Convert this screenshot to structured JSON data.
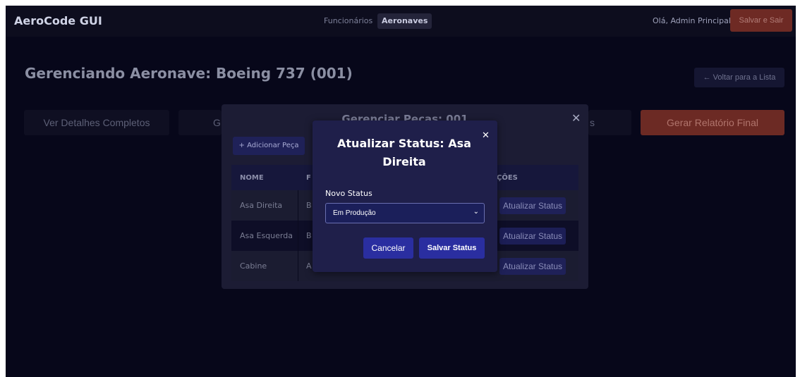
{
  "app": {
    "title": "AeroCode GUI"
  },
  "nav": {
    "items": [
      "Funcionários",
      "Aeronaves"
    ],
    "active": "Aeronaves"
  },
  "user": {
    "greeting": "Olá, Admin Principal",
    "logout_label": "Salvar e Sair"
  },
  "page": {
    "title": "Gerenciando Aeronave: Boeing 737 (001)",
    "back_label": "← Voltar para a Lista"
  },
  "actions": {
    "details_label": "Ver Detalhes Completos",
    "partial_left": "G",
    "partial_right": "s",
    "report_label": "Gerar Relatório Final"
  },
  "parts_modal": {
    "title": "Gerenciar Peças: 001",
    "add_label": "+ Adicionar Peça",
    "headers": {
      "name": "NOME",
      "second_partial": "F",
      "actions_partial": "ÇÕES"
    },
    "rows": [
      {
        "name": "Asa Direita",
        "second_partial": "B",
        "action": "Atualizar Status"
      },
      {
        "name": "Asa Esquerda",
        "second_partial": "B",
        "action": "Atualizar Status"
      },
      {
        "name": "Cabine",
        "second_partial": "A",
        "action": "Atualizar Status"
      }
    ],
    "close_glyph": "✕"
  },
  "status_modal": {
    "title": "Atualizar Status: Asa Direita",
    "field_label": "Novo Status",
    "selected_value": "Em Produção",
    "cancel_label": "Cancelar",
    "save_label": "Salvar Status",
    "close_glyph": "✕"
  },
  "colors": {
    "background": "#07071a",
    "danger": "#6e2a24",
    "primary": "#2a2ea0",
    "modal": "#1f1f4a"
  }
}
